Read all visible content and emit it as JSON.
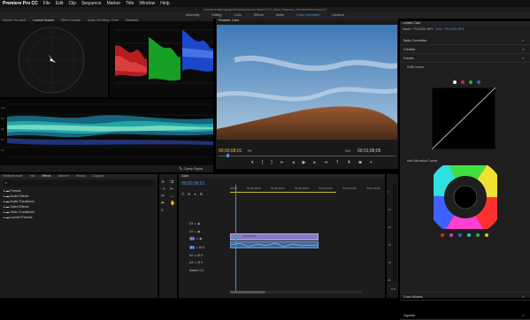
{
  "menu": {
    "app": "Premiere Pro CC",
    "items": [
      "File",
      "Edit",
      "Clip",
      "Sequence",
      "Marker",
      "Title",
      "Window",
      "Help"
    ]
  },
  "path": "/Users/createiriagmypo/Desktop/Lipoed Master/CC3_New_Features_Overview/mixed.prproj *",
  "workspaces": [
    "Assembly",
    "Editing",
    "Color",
    "Effects",
    "Audio",
    "Color Correction",
    "Libraries"
  ],
  "active_workspace_index": 5,
  "scopes": {
    "tabs": [
      "Source: (no clips)",
      "Lumetri Scopes",
      "Effect Controls",
      "Audio Clip Mixer: Color",
      "Metadata"
    ],
    "active": 1,
    "waveform_labels": [
      "100",
      "80",
      "60",
      "40",
      "20",
      "0"
    ],
    "parade_labels": [
      "100",
      "80",
      "60",
      "40",
      "20"
    ],
    "clamp": "Clamp Signal",
    "colors": {
      "red": "#d02020",
      "green": "#1fbf30",
      "blue": "#2050e0",
      "cyan": "#2ad0c0"
    }
  },
  "program": {
    "title": "Program: Color",
    "timecode": "00;00;08;01",
    "fit": "Fit",
    "quality": "Full",
    "duration": "00;01;08;05"
  },
  "lumetri": {
    "title": "Lumetri Color",
    "master": "Master * P1110001.MP4",
    "clip": "Color * P1110001.MP4",
    "sections": [
      "Basic Correction",
      "Creative",
      "Curves"
    ],
    "rgb_curves": "RGB Curves",
    "hue_sat": "Hue Saturation Curves",
    "bottom_sections": [
      "Color Wheels",
      "Vignette"
    ],
    "dot_colors": [
      "#ffffff",
      "#e03030",
      "#30c040",
      "#3060e0"
    ]
  },
  "project": {
    "tabs": [
      "Media Browser",
      "Info",
      "Effects",
      "Markers",
      "History",
      "Captions"
    ],
    "active": 2,
    "items": [
      "Presets",
      "Audio Effects",
      "Audio Transitions",
      "Video Effects",
      "Video Transitions",
      "Lumetri Presets"
    ]
  },
  "timeline": {
    "tab": "Color",
    "timecode": "00;00;08;01",
    "ruler": [
      "00;00",
      "00;00;16;00",
      "00;00;32;00",
      "00;00;48;00",
      "00;01;04;02",
      "00;01;20;02",
      "00;01;36;02",
      "00;01;52;02"
    ],
    "video_tracks": [
      "V3",
      "V2",
      "V1"
    ],
    "audio_tracks": [
      "A1",
      "A2",
      "A3"
    ],
    "master": "Master",
    "master_val": "0.0"
  },
  "meter_labels": [
    "0",
    "-12",
    "-24",
    "-36",
    "-48",
    "dB"
  ]
}
